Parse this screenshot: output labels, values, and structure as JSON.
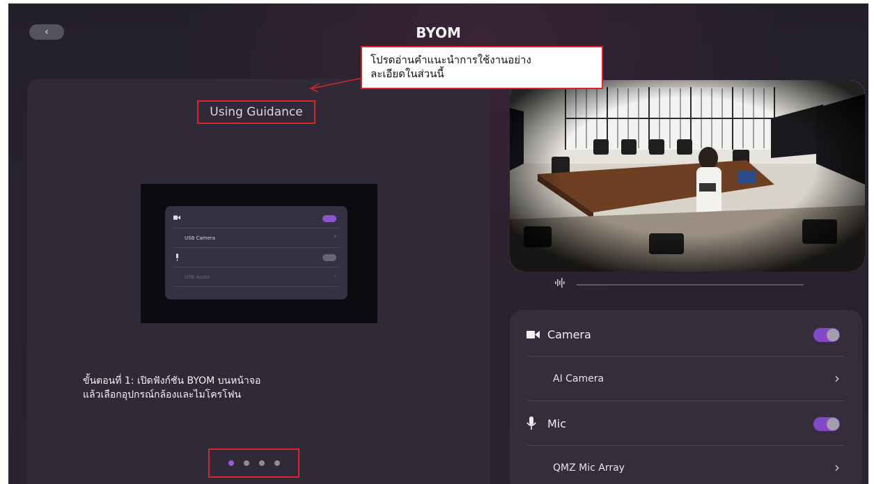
{
  "window": {
    "title": "BYOM",
    "back_icon": "chevron-left-icon"
  },
  "guide": {
    "heading": "Using Guidance",
    "step_line1": "ขั้นตอนที่ 1: เปิดฟังก์ชัน BYOM บนหน้าจอ",
    "step_line2": "แล้วเลือกอุปกรณ์กล้องและไมโครโฟน",
    "mini": {
      "camera_device": "USB Camera",
      "audio_device": "USB Audio"
    },
    "pager": {
      "count": 4,
      "active": 1
    }
  },
  "callout": {
    "line1": "โปรดอ่านคำแนะนำการใช้งานอย่าง",
    "line2": "ละเอียดในส่วนนี้"
  },
  "preview": {
    "audio_icon": "audio-wave-icon"
  },
  "settings": {
    "camera_label": "Camera",
    "camera_enabled": true,
    "camera_device": "AI Camera",
    "mic_label": "Mic",
    "mic_enabled": true,
    "mic_device": "QMZ Mic Array"
  },
  "colors": {
    "accent": "#8449c6",
    "highlight": "#d9262b",
    "background": "#27222e"
  }
}
